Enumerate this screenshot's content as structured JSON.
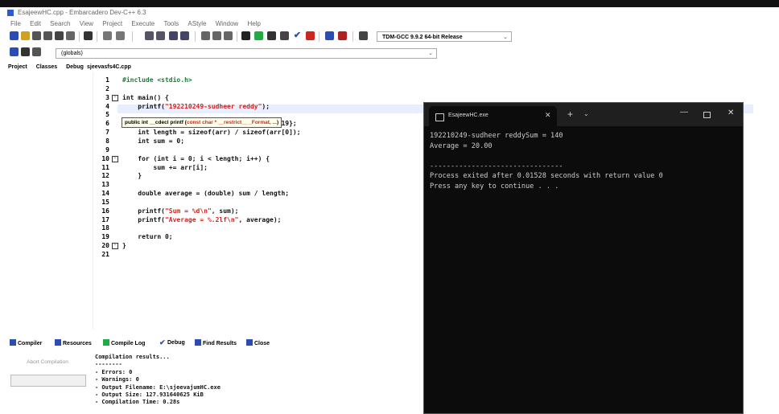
{
  "window": {
    "title": "EsajeewHC.cpp - Embarcadero Dev-C++ 6.3",
    "menu": [
      "File",
      "Edit",
      "Search",
      "View",
      "Project",
      "Execute",
      "Tools",
      "AStyle",
      "Window",
      "Help"
    ]
  },
  "toolbar": {
    "compiler": "TDM-GCC 9.9.2 64-bit Release",
    "scope": "(globals)"
  },
  "left_panel": {
    "tabs": [
      "Project",
      "Classes",
      "Debug"
    ]
  },
  "editor": {
    "file_tab": "sjeevasfs4C.cpp",
    "line_numbers": [
      "1",
      "2",
      "3",
      "4",
      "5",
      "6",
      "7",
      "8",
      "9",
      "10",
      "11",
      "12",
      "13",
      "14",
      "15",
      "16",
      "17",
      "18",
      "19",
      "20",
      "21"
    ],
    "lines": [
      "#include <stdio.h>",
      "",
      "int main() {",
      "    printf(\"192210249-sudheer reddy\");",
      "",
      "    int arr[] = {15, 18, 27, 16, 23, 21, 19};",
      "    int length = sizeof(arr) / sizeof(arr[0]);",
      "    int sum = 0;",
      "",
      "    for (int i = 0; i < length; i++) {",
      "        sum += arr[i];",
      "    }",
      "",
      "    double average = (double) sum / length;",
      "",
      "    printf(\"Sum = %d\\n\", sum);",
      "    printf(\"Average = %.2lf\\n\", average);",
      "",
      "    return 0;",
      "}",
      ""
    ],
    "tooltip": {
      "prefix": "public int __cdecl printf (",
      "params": "const char * __restrict__ _Format, ...",
      "suffix": ")"
    }
  },
  "bottom": {
    "tabs": [
      "Compiler",
      "Resources",
      "Compile Log",
      "Debug",
      "Find Results",
      "Close"
    ],
    "abort_label": "Abort Compilation",
    "output": [
      "Compilation results...",
      "--------",
      "- Errors: 0",
      "- Warnings: 0",
      "- Output Filename: E:\\sjeevajumHC.exe",
      "- Output Size: 127.931640625 KiB",
      "- Compilation Time: 0.28s"
    ]
  },
  "console": {
    "tab_title": "EsajeewHC.exe",
    "lines": [
      "192210249-sudheer reddySum = 140",
      "Average = 20.00",
      "",
      "--------------------------------",
      "Process exited after 0.01528 seconds with return value 0",
      "Press any key to continue . . ."
    ]
  },
  "colors": {
    "keyword": "#111111",
    "string": "#d0241f",
    "preprocessor": "#1c7c34",
    "current_line": "#e8eefd",
    "console_bg": "#0c0c0c"
  }
}
